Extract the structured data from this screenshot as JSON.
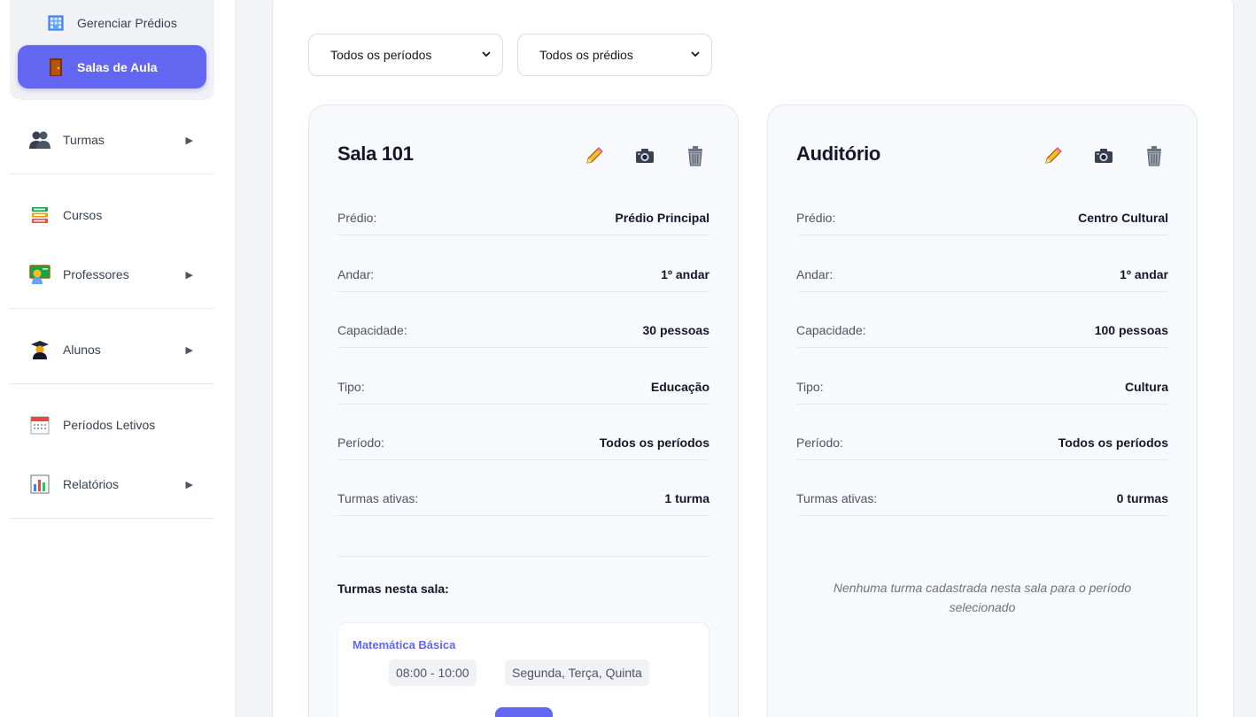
{
  "sidebar": {
    "sub_items": [
      {
        "label": "Gerenciar Prédios",
        "icon": "building-icon"
      },
      {
        "label": "Salas de Aula",
        "icon": "door-icon",
        "active": true
      }
    ],
    "items": [
      {
        "label": "Turmas",
        "icon": "people-icon",
        "has_arrow": true
      },
      {
        "label": "Cursos",
        "icon": "books-icon",
        "has_arrow": false
      },
      {
        "label": "Professores",
        "icon": "teacher-icon",
        "has_arrow": true
      },
      {
        "label": "Alunos",
        "icon": "student-icon",
        "has_arrow": true
      },
      {
        "label": "Períodos Letivos",
        "icon": "calendar-icon",
        "has_arrow": false
      },
      {
        "label": "Relatórios",
        "icon": "bar-chart-icon",
        "has_arrow": true
      }
    ],
    "arrow_glyph": "▶"
  },
  "filters": {
    "period": "Todos os períodos",
    "building": "Todos os prédios"
  },
  "labels": {
    "predio": "Prédio:",
    "andar": "Andar:",
    "capacidade": "Capacidade:",
    "tipo": "Tipo:",
    "periodo": "Período:",
    "turmas_ativas": "Turmas ativas:",
    "turmas_nesta_sala": "Turmas nesta sala:"
  },
  "rooms": [
    {
      "name": "Sala 101",
      "predio": "Prédio Principal",
      "andar": "1º andar",
      "capacidade": "30 pessoas",
      "tipo": "Educação",
      "periodo": "Todos os períodos",
      "turmas_ativas": "1 turma",
      "turmas": [
        {
          "name": "Matemática Básica",
          "horario": "08:00 - 10:00",
          "dias": "Segunda, Terça, Quinta"
        }
      ]
    },
    {
      "name": "Auditório",
      "predio": "Centro Cultural",
      "andar": "1º andar",
      "capacidade": "100 pessoas",
      "tipo": "Cultura",
      "periodo": "Todos os períodos",
      "turmas_ativas": "0 turmas",
      "empty_message": "Nenhuma turma cadastrada nesta sala para o período selecionado"
    }
  ],
  "colors": {
    "accent": "#6366f1",
    "page_bg": "#f3f4f8",
    "card_bg": "#f8f9fc"
  }
}
